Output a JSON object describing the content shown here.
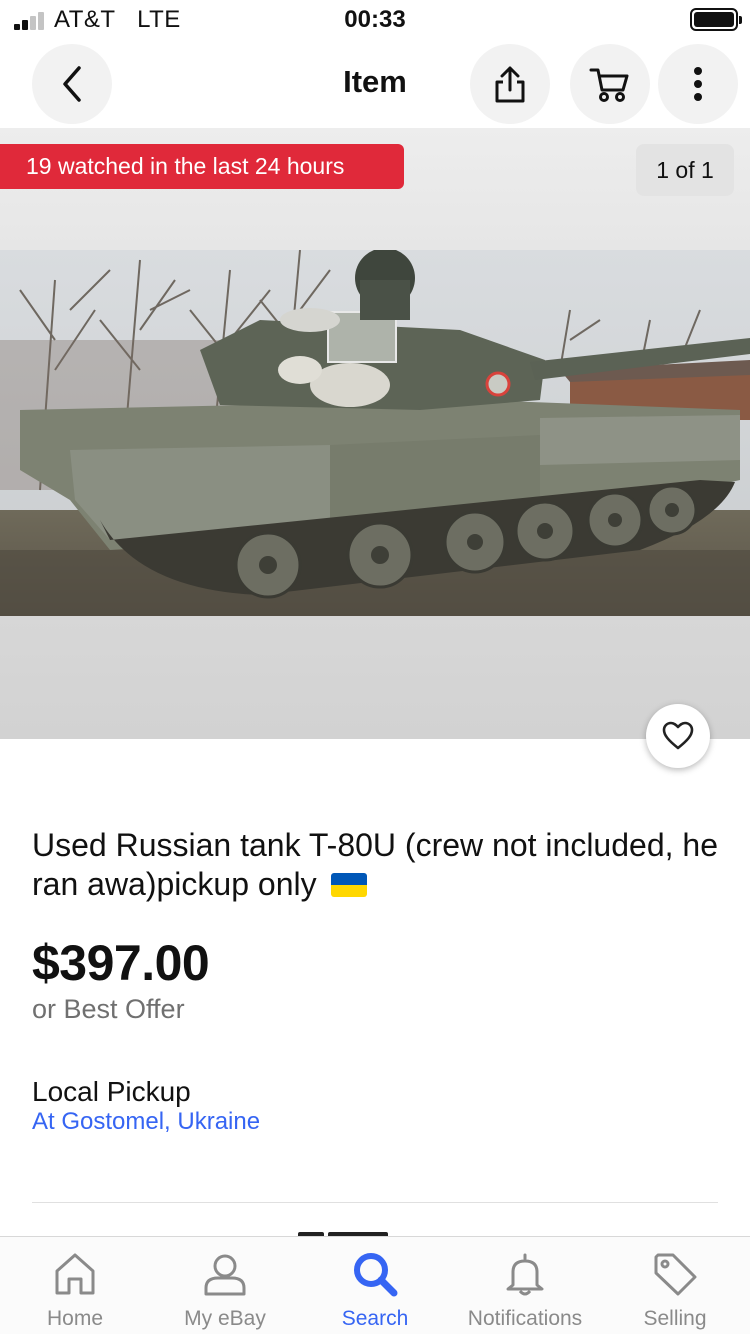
{
  "status_bar": {
    "carrier": "AT&T",
    "network": "LTE",
    "time": "00:33"
  },
  "header": {
    "title": "Item",
    "back_icon": "chevron-left-icon",
    "share_icon": "share-icon",
    "cart_icon": "cart-icon",
    "more_icon": "more-vertical-icon"
  },
  "gallery": {
    "watch_banner": "19 watched in the last 24 hours",
    "counter": "1 of 1",
    "favorite_icon": "heart-icon"
  },
  "item": {
    "title": "Used Russian tank T-80U (crew not included, he ran awa)pickup only",
    "title_flag_icon": "ukraine-flag-icon",
    "price": "$397.00",
    "offer": "or Best Offer",
    "pickup_title": "Local Pickup",
    "pickup_location": "At Gostomel, Ukraine"
  },
  "tab_bar": {
    "items": [
      {
        "label": "Home",
        "icon": "home-icon",
        "active": false
      },
      {
        "label": "My eBay",
        "icon": "person-icon",
        "active": false
      },
      {
        "label": "Search",
        "icon": "search-icon",
        "active": true
      },
      {
        "label": "Notifications",
        "icon": "bell-icon",
        "active": false
      },
      {
        "label": "Selling",
        "icon": "tag-icon",
        "active": false
      }
    ]
  },
  "colors": {
    "accent": "#3665f3",
    "banner": "#e0293a",
    "flag_blue": "#0057b7",
    "flag_yellow": "#ffd700"
  }
}
